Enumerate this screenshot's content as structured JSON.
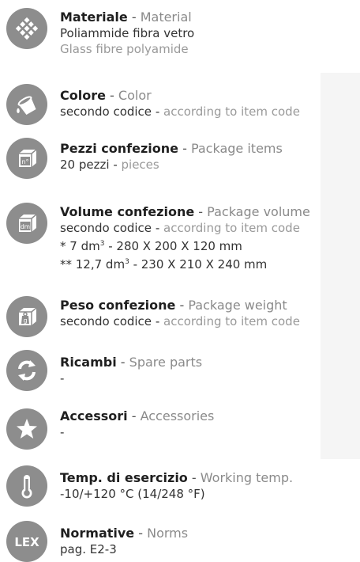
{
  "items": [
    {
      "icon": "diamond-grid-icon",
      "title_it": "Materiale",
      "title_en": "Material",
      "line1": "Poliammide fibra vetro",
      "line2": "Glass fibre polyamide"
    },
    {
      "icon": "paint-bucket-icon",
      "title_it": "Colore",
      "title_en": "Color",
      "line1_it": "secondo codice",
      "line1_en": "according to item code"
    },
    {
      "icon": "box-pieces-icon",
      "title_it": "Pezzi confezione",
      "title_en": "Package items",
      "line1_it": "20 pezzi",
      "line1_en": "pieces",
      "icon_text": "n°"
    },
    {
      "icon": "box-volume-icon",
      "title_it": "Volume confezione",
      "title_en": "Package volume",
      "line1_it": "secondo codice",
      "line1_en": "according to item code",
      "line2_pre": "* 7 dm",
      "line2_post": " - 280 X 200 X 120 mm",
      "line3_pre": "** 12,7 dm",
      "line3_post": " - 230 X 210 X 240 mm",
      "sup": "3",
      "icon_text": "dm"
    },
    {
      "icon": "weight-scale-icon",
      "title_it": "Peso confezione",
      "title_en": "Package weight",
      "line1_it": "secondo codice",
      "line1_en": "according to item code",
      "icon_text": "g"
    },
    {
      "icon": "refresh-arrows-icon",
      "title_it": "Ricambi",
      "title_en": "Spare parts",
      "line1": "-"
    },
    {
      "icon": "star-icon",
      "title_it": "Accessori",
      "title_en": "Accessories",
      "line1": "-"
    },
    {
      "icon": "thermometer-icon",
      "title_it": "Temp. di esercizio",
      "title_en": "Working temp.",
      "line1": "-10/+120 °C (14/248 °F)"
    },
    {
      "icon": "lex-icon",
      "title_it": "Normative",
      "title_en": "Norms",
      "line1": "pag. E2-3",
      "icon_text": "LEX"
    }
  ],
  "separator": "-",
  "colors": {
    "icon_bg": "#8d8d8d",
    "accent_gray": "#8a8a8a",
    "panel_bg": "#f5f5f5"
  }
}
